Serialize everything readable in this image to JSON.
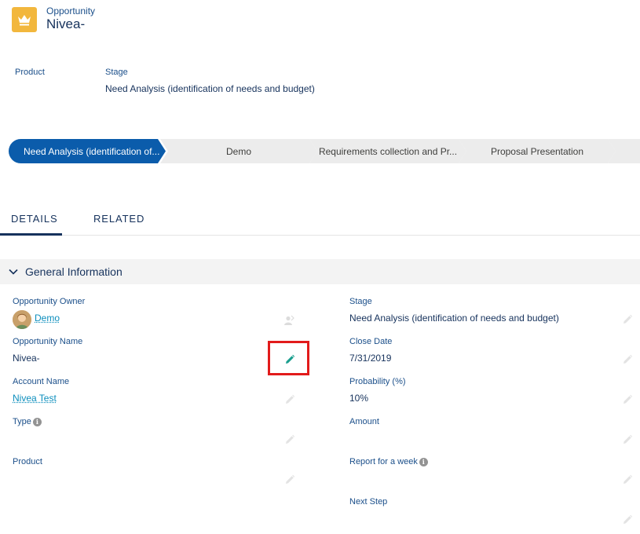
{
  "header": {
    "object_type": "Opportunity",
    "record_name": "Nivea-",
    "icon": "crown-icon",
    "icon_color": "#f2b73d"
  },
  "highlights": {
    "product_label": "Product",
    "product_value": "",
    "stage_label": "Stage",
    "stage_value": "Need Analysis (identification of needs and budget)"
  },
  "path": {
    "stages": [
      {
        "label": "Need Analysis (identification of...",
        "active": true
      },
      {
        "label": "Demo",
        "active": false
      },
      {
        "label": "Requirements collection and Pr...",
        "active": false
      },
      {
        "label": "Proposal Presentation",
        "active": false
      }
    ],
    "active_color": "#0b5cab"
  },
  "tabs": [
    {
      "label": "DETAILS",
      "selected": true
    },
    {
      "label": "RELATED",
      "selected": false
    }
  ],
  "section": {
    "title": "General Information"
  },
  "fields": {
    "left": [
      {
        "label": "Opportunity Owner",
        "value": "Demo"
      },
      {
        "label": "Opportunity Name",
        "value": "Nivea-"
      },
      {
        "label": "Account Name",
        "value": "Nivea Test"
      },
      {
        "label": "Type",
        "value": ""
      },
      {
        "label": "Product",
        "value": ""
      }
    ],
    "right": [
      {
        "label": "Stage",
        "value": "Need Analysis (identification of needs and budget)"
      },
      {
        "label": "Close Date",
        "value": "7/31/2019"
      },
      {
        "label": "Probability (%)",
        "value": "10%"
      },
      {
        "label": "Amount",
        "value": ""
      },
      {
        "label": "Report for a week",
        "value": ""
      },
      {
        "label": "Next Step",
        "value": ""
      }
    ]
  },
  "colors": {
    "link": "#0c8ebd",
    "highlight": "#e21b1b",
    "edit_active": "#1a9e8e"
  }
}
